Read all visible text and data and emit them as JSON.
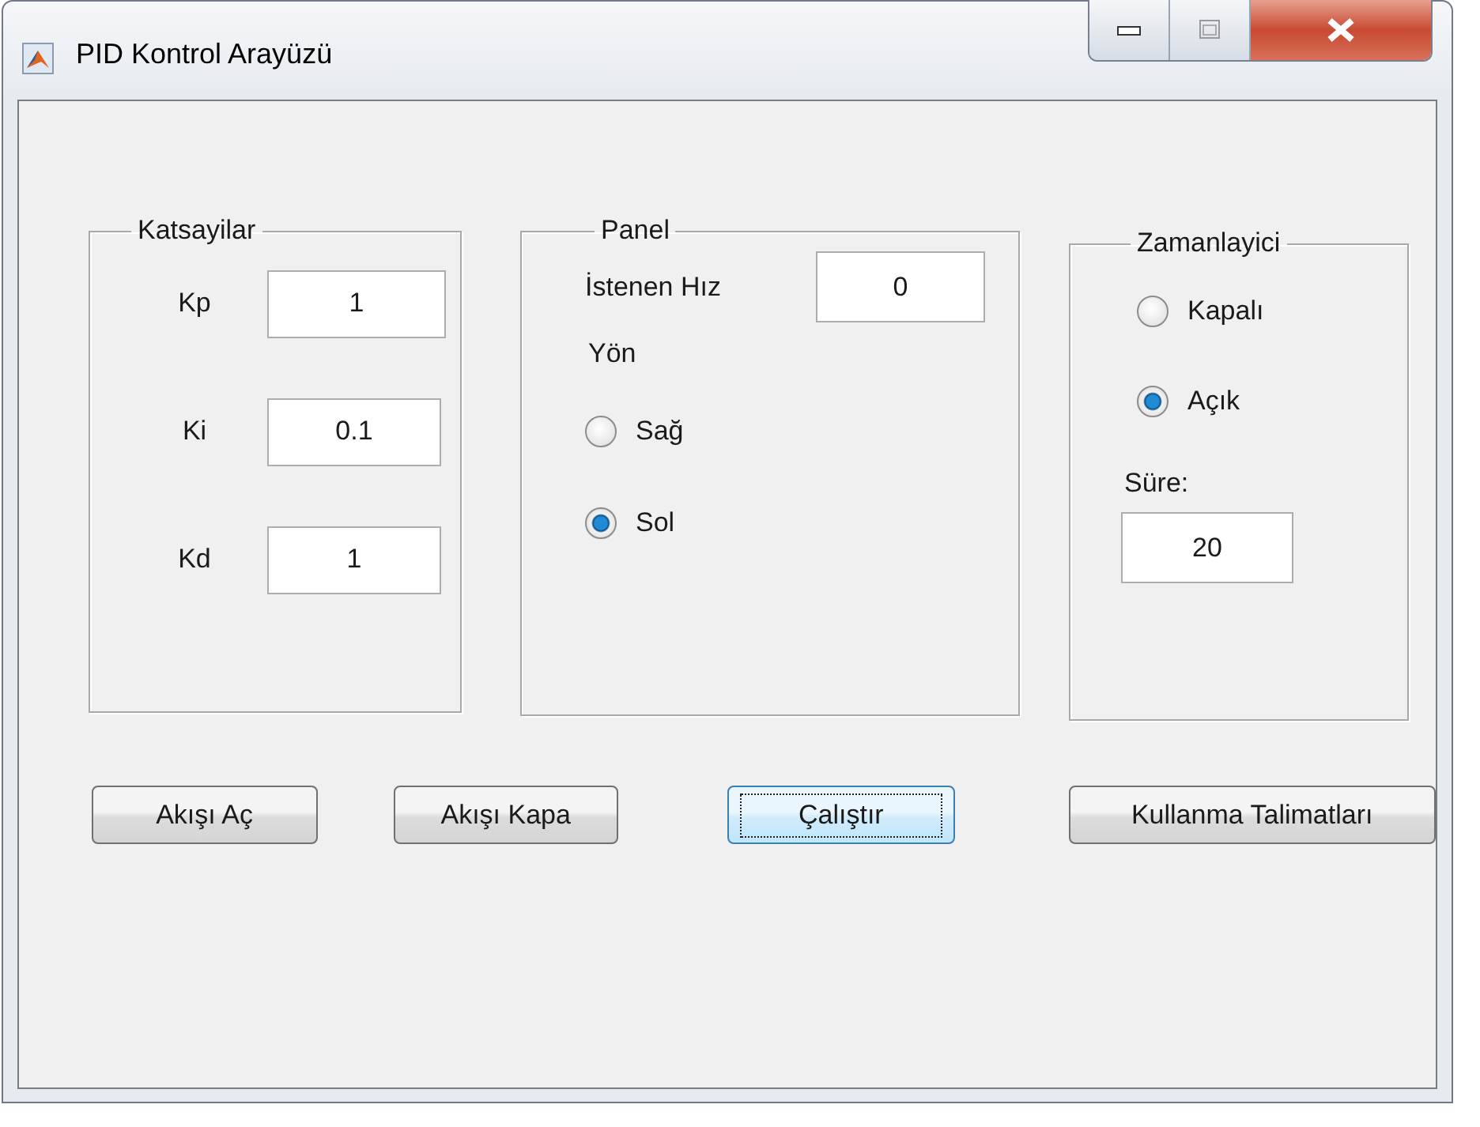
{
  "window": {
    "title": "PID Kontrol Arayüzü"
  },
  "coefficients": {
    "title": "Katsayilar",
    "fields": [
      {
        "label": "Kp",
        "value": "1"
      },
      {
        "label": "Ki",
        "value": "0.1"
      },
      {
        "label": "Kd",
        "value": "1"
      }
    ]
  },
  "panel": {
    "title": "Panel",
    "speed": {
      "label": "İstenen Hız",
      "value": "0"
    },
    "direction_label": "Yön",
    "options": [
      {
        "label": "Sağ",
        "selected": false
      },
      {
        "label": "Sol",
        "selected": true
      }
    ]
  },
  "timer": {
    "title": "Zamanlayici",
    "options": [
      {
        "label": "Kapalı",
        "selected": false
      },
      {
        "label": "Açık",
        "selected": true
      }
    ],
    "duration": {
      "label": "Süre:",
      "value": "20"
    }
  },
  "buttons": [
    {
      "label": "Akışı Aç",
      "focused": false
    },
    {
      "label": "Akışı Kapa",
      "focused": false
    },
    {
      "label": "Çalıştır",
      "focused": true
    },
    {
      "label": "Kullanma Talimatları",
      "focused": false
    }
  ]
}
